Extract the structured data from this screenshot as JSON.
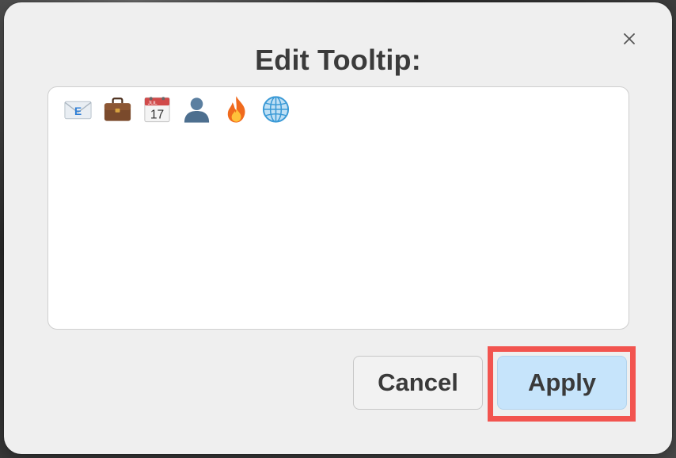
{
  "dialog": {
    "title": "Edit Tooltip:",
    "close_icon": "close-icon",
    "cancel_label": "Cancel",
    "apply_label": "Apply",
    "apply_highlight_color": "#f2544f",
    "apply_bg_color": "#c6e4fb"
  },
  "editor": {
    "emojis": [
      {
        "name": "envelope-icon",
        "calendar_day": ""
      },
      {
        "name": "briefcase-icon",
        "calendar_day": ""
      },
      {
        "name": "calendar-icon",
        "month": "JUL",
        "day": "17"
      },
      {
        "name": "person-silhouette-icon"
      },
      {
        "name": "fire-icon"
      },
      {
        "name": "globe-icon"
      }
    ]
  }
}
